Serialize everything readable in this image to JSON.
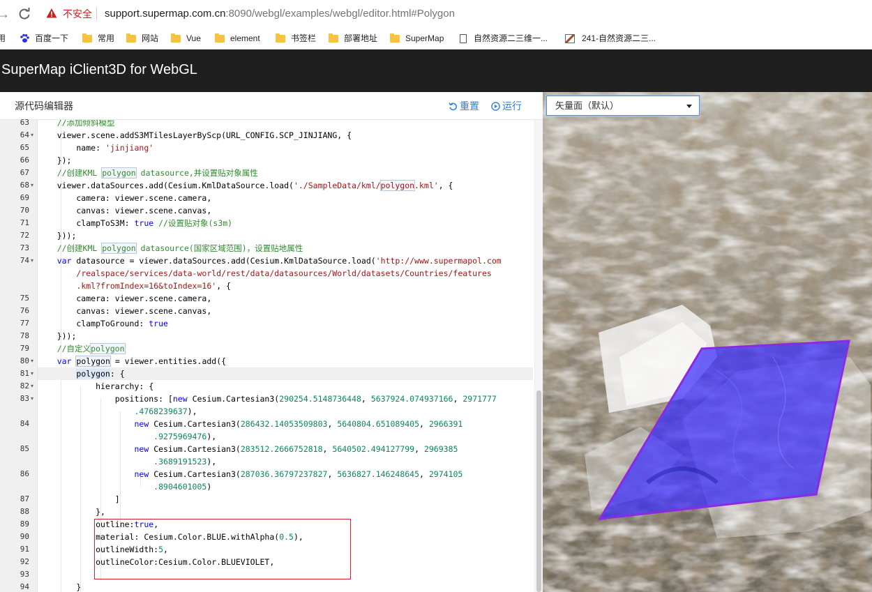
{
  "browser": {
    "insecure_label": "不安全",
    "url_host": "support.supermap.com.cn",
    "url_rest": ":8090/webgl/examples/webgl/editor.html#Polygon"
  },
  "bookmarks": [
    {
      "label": "用",
      "icon": "none"
    },
    {
      "label": "百度一下",
      "icon": "paw-icon"
    },
    {
      "label": "常用",
      "icon": "folder-icon"
    },
    {
      "label": "网站",
      "icon": "folder-icon"
    },
    {
      "label": "Vue",
      "icon": "folder-icon"
    },
    {
      "label": "element",
      "icon": "folder-icon"
    },
    {
      "label": "书签栏",
      "icon": "folder-icon"
    },
    {
      "label": "部署地址",
      "icon": "folder-icon"
    },
    {
      "label": "SuperMap",
      "icon": "folder-icon"
    },
    {
      "label": "自然资源二三维一...",
      "icon": "page-icon"
    },
    {
      "label": "241-自然资源二三...",
      "icon": "image-icon"
    }
  ],
  "app": {
    "title": "SuperMap iClient3D for WebGL"
  },
  "editor": {
    "title": "源代码编辑器",
    "reset_label": "重置",
    "run_label": "运行",
    "lines": [
      {
        "n": "63",
        "fold": false,
        "active": false,
        "html": "    <span class=\"cm\">//添加倾斜模型</span>"
      },
      {
        "n": "64",
        "fold": true,
        "active": false,
        "html": "    viewer.scene.addS3MTilesLayerByScp(URL_CONFIG.SCP_JINJIANG, {"
      },
      {
        "n": "65",
        "fold": false,
        "active": false,
        "html": "        name: <span class=\"str\">'jinjiang'</span>"
      },
      {
        "n": "66",
        "fold": false,
        "active": false,
        "html": "    });"
      },
      {
        "n": "67",
        "fold": false,
        "active": false,
        "html": "    <span class=\"cm\">//创建KML <span class=\"hl\">polygon</span> datasource,并设置贴对象属性</span>"
      },
      {
        "n": "68",
        "fold": true,
        "active": false,
        "html": "    viewer.dataSources.add(Cesium.KmlDataSource.load(<span class=\"str\">'./SampleData/kml/<span class=\"hl\">polygon</span>.kml'</span>, {"
      },
      {
        "n": "69",
        "fold": false,
        "active": false,
        "html": "        camera: viewer.scene.camera,"
      },
      {
        "n": "70",
        "fold": false,
        "active": false,
        "html": "        canvas: viewer.scene.canvas,"
      },
      {
        "n": "71",
        "fold": false,
        "active": false,
        "html": "        clampToS3M: <span class=\"kw\">true</span> <span class=\"cm\">//设置贴对象(s3m)</span>"
      },
      {
        "n": "72",
        "fold": false,
        "active": false,
        "html": "    }));"
      },
      {
        "n": "73",
        "fold": false,
        "active": false,
        "html": "    <span class=\"cm\">//创建KML <span class=\"hl\">polygon</span> datasource(国家区域范围)，设置贴地属性</span>"
      },
      {
        "n": "74",
        "fold": true,
        "active": false,
        "html": "    <span class=\"kw\">var</span> datasource = viewer.dataSources.add(Cesium.KmlDataSource.load(<span class=\"str\">'http://www.supermapol.com</span>"
      },
      {
        "n": "",
        "fold": false,
        "active": false,
        "html": "        <span class=\"str\">/realspace/services/data-world/rest/data/datasources/World/datasets/Countries/features</span>"
      },
      {
        "n": "",
        "fold": false,
        "active": false,
        "html": "        <span class=\"str\">.kml?fromIndex=16&toIndex=16'</span>, {"
      },
      {
        "n": "75",
        "fold": false,
        "active": false,
        "html": "        camera: viewer.scene.camera,"
      },
      {
        "n": "76",
        "fold": false,
        "active": false,
        "html": "        canvas: viewer.scene.canvas,"
      },
      {
        "n": "77",
        "fold": false,
        "active": false,
        "html": "        clampToGround: <span class=\"kw\">true</span>"
      },
      {
        "n": "78",
        "fold": false,
        "active": false,
        "html": "    }));"
      },
      {
        "n": "79",
        "fold": false,
        "active": false,
        "html": "    <span class=\"cm\">//自定义<span class=\"hl\">polygon</span></span>"
      },
      {
        "n": "80",
        "fold": true,
        "active": false,
        "html": "    <span class=\"kw\">var</span> <span class=\"hl\">polygon</span> = viewer.entities.add({"
      },
      {
        "n": "81",
        "fold": true,
        "active": true,
        "html": "        <span class=\"hl2\">polygon</span>: {"
      },
      {
        "n": "82",
        "fold": true,
        "active": false,
        "html": "            hierarchy: {"
      },
      {
        "n": "83",
        "fold": true,
        "active": false,
        "html": "                positions: [<span class=\"kw\">new</span> Cesium.Cartesian3(<span class=\"num\">290254.5148736448</span>, <span class=\"num\">5637924.074937166</span>, <span class=\"num\">2971777</span>"
      },
      {
        "n": "",
        "fold": false,
        "active": false,
        "html": "                    <span class=\"num\">.4768239637</span>),"
      },
      {
        "n": "84",
        "fold": false,
        "active": false,
        "html": "                    <span class=\"kw\">new</span> Cesium.Cartesian3(<span class=\"num\">286432.14053509803</span>, <span class=\"num\">5640804.651089405</span>, <span class=\"num\">2966391</span>"
      },
      {
        "n": "",
        "fold": false,
        "active": false,
        "html": "                        <span class=\"num\">.9275969476</span>),"
      },
      {
        "n": "85",
        "fold": false,
        "active": false,
        "html": "                    <span class=\"kw\">new</span> Cesium.Cartesian3(<span class=\"num\">283512.2666752818</span>, <span class=\"num\">5640502.494127799</span>, <span class=\"num\">2969385</span>"
      },
      {
        "n": "",
        "fold": false,
        "active": false,
        "html": "                        <span class=\"num\">.3689191523</span>),"
      },
      {
        "n": "86",
        "fold": false,
        "active": false,
        "html": "                    <span class=\"kw\">new</span> Cesium.Cartesian3(<span class=\"num\">287036.36797237827</span>, <span class=\"num\">5636827.146248645</span>, <span class=\"num\">2974105</span>"
      },
      {
        "n": "",
        "fold": false,
        "active": false,
        "html": "                        <span class=\"num\">.8904601005</span>)"
      },
      {
        "n": "87",
        "fold": false,
        "active": false,
        "html": "                ]"
      },
      {
        "n": "88",
        "fold": false,
        "active": false,
        "html": "            },"
      },
      {
        "n": "89",
        "fold": false,
        "active": false,
        "html": "            outline:<span class=\"kw\">true</span>,"
      },
      {
        "n": "90",
        "fold": false,
        "active": false,
        "html": "            material: Cesium.Color.BLUE.withAlpha(<span class=\"num\">0.5</span>),"
      },
      {
        "n": "91",
        "fold": false,
        "active": false,
        "html": "            outlineWidth:<span class=\"num\">5</span>,"
      },
      {
        "n": "92",
        "fold": false,
        "active": false,
        "html": "            outlineColor:Cesium.Color.BLUEVIOLET,"
      },
      {
        "n": "93",
        "fold": false,
        "active": false,
        "html": ""
      },
      {
        "n": "94",
        "fold": false,
        "active": false,
        "html": "        }"
      }
    ]
  },
  "map": {
    "layer_select_value": "矢量面（默认）",
    "polygon_fill": "#3a2cff",
    "polygon_outline": "#8a2be2"
  },
  "colors": {
    "header_bg": "#1f1f1f",
    "accent": "#2a7de1",
    "annotation_box": "#d3222a"
  }
}
